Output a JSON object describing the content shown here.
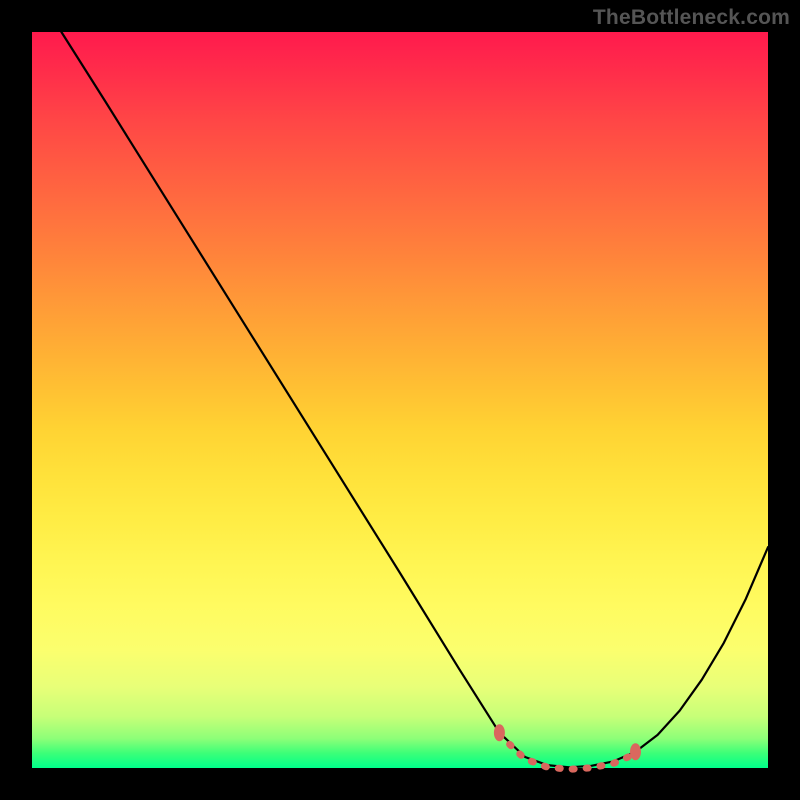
{
  "watermark": "TheBottleneck.com",
  "chart_data": {
    "type": "line",
    "title": "",
    "xlabel": "",
    "ylabel": "",
    "xlim": [
      0,
      100
    ],
    "ylim": [
      0,
      100
    ],
    "grid": false,
    "legend": false,
    "series": [
      {
        "name": "curve",
        "x": [
          4,
          10,
          20,
          30,
          40,
          50,
          58,
          63.5,
          67,
          70,
          73,
          76,
          79,
          82,
          85,
          88,
          91,
          94,
          97,
          100
        ],
        "y": [
          100,
          90.5,
          74.5,
          58.5,
          42.5,
          26.5,
          13.5,
          4.8,
          1.5,
          0.4,
          0.1,
          0.3,
          0.9,
          2.2,
          4.5,
          7.8,
          12,
          17,
          23,
          30
        ]
      }
    ],
    "markers": [
      {
        "x": 63.5,
        "y": 4.8
      },
      {
        "x": 82,
        "y": 2.2
      }
    ],
    "dotted_segment": {
      "x": [
        63.5,
        82
      ],
      "y_approx": [
        4.8,
        2.2
      ]
    },
    "background_gradient": {
      "top_color": "#ff1a4d",
      "bottom_color": "#00ff8a"
    }
  }
}
